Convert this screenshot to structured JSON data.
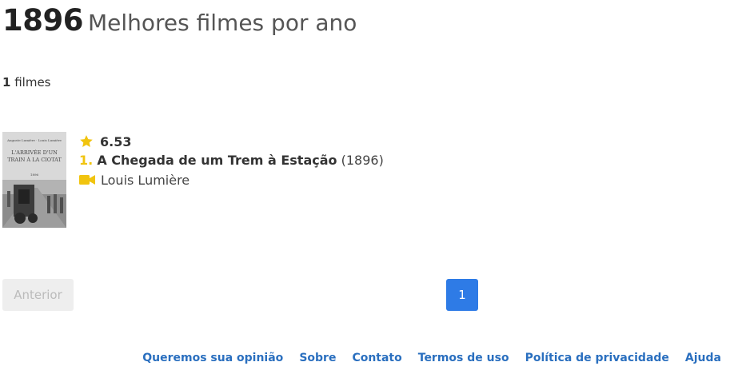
{
  "header": {
    "year": "1896",
    "subtitle": "Melhores filmes por ano"
  },
  "count": {
    "number": "1",
    "label": "filmes"
  },
  "movies": [
    {
      "rating": "6.53",
      "rank": "1.",
      "title": "A Chegada de um Trem à Estação",
      "year": "(1896)",
      "director": "Louis Lumière",
      "poster": {
        "line1": "Auguste Lumière · Louis Lumière",
        "line2": "L'ARRIVÉE D'UN",
        "line3": "TRAIN À LA CIOTAT",
        "line4": "1896"
      }
    }
  ],
  "pagination": {
    "prev_label": "Anterior",
    "current_page": "1"
  },
  "footer": {
    "links": [
      "Queremos sua opinião",
      "Sobre",
      "Contato",
      "Termos de uso",
      "Política de privacidade",
      "Ajuda"
    ]
  },
  "colors": {
    "accent": "#2e7be6",
    "star": "#f1c40f",
    "link": "#2a6fbf"
  },
  "icons": {
    "rating": "star-icon",
    "director": "video-camera-icon"
  }
}
